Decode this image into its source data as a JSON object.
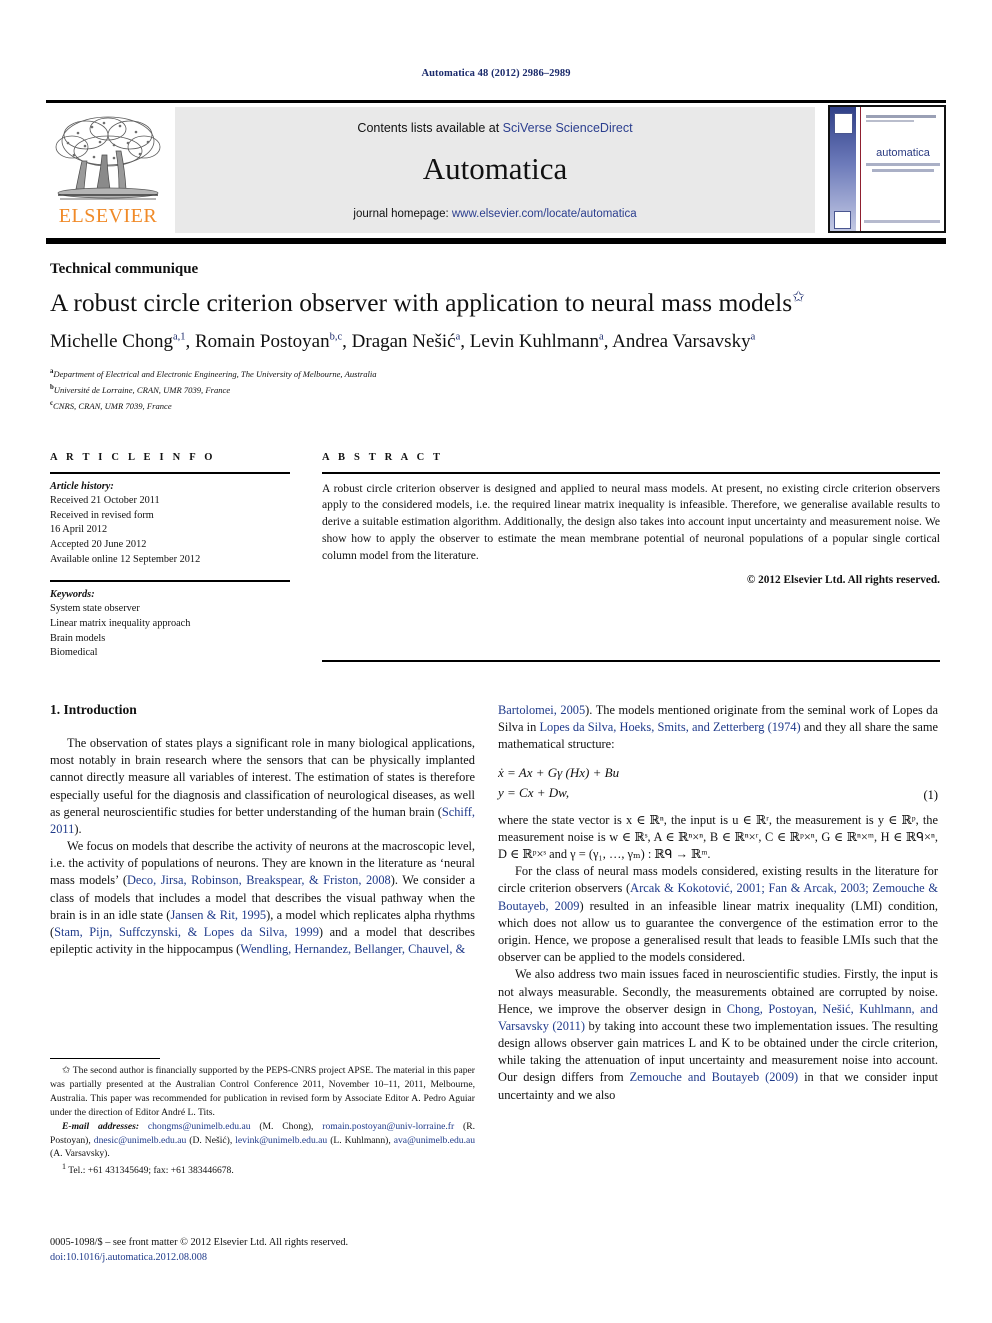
{
  "running_head": "Automatica 48 (2012) 2986–2989",
  "masthead": {
    "contents_prefix": "Contents lists available at ",
    "contents_link": "SciVerse ScienceDirect",
    "journal_title": "Automatica",
    "homepage_prefix": "journal homepage: ",
    "homepage_url": "www.elsevier.com/locate/automatica",
    "publisher_name": "ELSEVIER",
    "cover_journal_name": "automatica"
  },
  "article": {
    "section_label": "Technical communique",
    "title": "A robust circle criterion observer with application to neural mass models",
    "title_footnote_marker": "✩",
    "authors": [
      {
        "name": "Michelle Chong",
        "marks": "a,1"
      },
      {
        "name": "Romain Postoyan",
        "marks": "b,c"
      },
      {
        "name": "Dragan Nešić",
        "marks": "a"
      },
      {
        "name": "Levin Kuhlmann",
        "marks": "a"
      },
      {
        "name": "Andrea Varsavsky",
        "marks": "a"
      }
    ],
    "affiliations": [
      {
        "mark": "a",
        "text": "Department of Electrical and Electronic Engineering, The University of Melbourne, Australia"
      },
      {
        "mark": "b",
        "text": "Université de Lorraine, CRAN, UMR 7039, France"
      },
      {
        "mark": "c",
        "text": "CNRS, CRAN, UMR 7039, France"
      }
    ]
  },
  "article_info": {
    "heading": "A R T I C L E    I N F O",
    "history_label": "Article history:",
    "history": [
      "Received 21 October 2011",
      "Received in revised form",
      "16 April 2012",
      "Accepted 20 June 2012",
      "Available online 12 September 2012"
    ],
    "keywords_label": "Keywords:",
    "keywords": [
      "System state observer",
      "Linear matrix inequality approach",
      "Brain models",
      "Biomedical"
    ]
  },
  "abstract": {
    "heading": "A B S T R A C T",
    "text": "A robust circle criterion observer is designed and applied to neural mass models. At present, no existing circle criterion observers apply to the considered models, i.e. the required linear matrix inequality is infeasible. Therefore, we generalise available results to derive a suitable estimation algorithm. Additionally, the design also takes into account input uncertainty and measurement noise. We show how to apply the observer to estimate the mean membrane potential of neuronal populations of a popular single cortical column model from the literature.",
    "copyright": "© 2012 Elsevier Ltd. All rights reserved."
  },
  "body": {
    "section_number_title": "1. Introduction",
    "left_p1": "The observation of states plays a significant role in many biological applications, most notably in brain research where the sensors that can be physically implanted cannot directly measure all variables of interest. The estimation of states is therefore especially useful for the diagnosis and classification of neurological diseases, as well as general neuroscientific studies for better understanding of the human brain (",
    "left_p1_ref": "Schiff, 2011",
    "left_p1_tail": ").",
    "left_p2_a": "We focus on models that describe the activity of neurons at the macroscopic level, i.e. the activity of populations of neurons. They are known in the literature as ‘neural mass models’ (",
    "left_p2_ref1": "Deco, Jirsa, Robinson, Breakspear, & Friston, 2008",
    "left_p2_b": "). We consider a class of models that includes a model that describes the visual pathway when the brain is in an idle state (",
    "left_p2_ref2": "Jansen & Rit, 1995",
    "left_p2_c": "), a model which replicates alpha rhythms (",
    "left_p2_ref3": "Stam, Pijn, Suffczynski, & Lopes da Silva, 1999",
    "left_p2_d": ") and a model that describes epileptic activity in the hippocampus (",
    "left_p2_ref4": "Wendling, Hernandez, Bellanger, Chauvel, &",
    "right_p1_ref1": "Bartolomei, 2005",
    "right_p1_a": "). The models mentioned originate from the seminal work of Lopes da Silva in ",
    "right_p1_ref2": "Lopes da Silva, Hoeks, Smits, and Zetterberg (1974)",
    "right_p1_b": " and they all share the same mathematical structure:",
    "equation_line1": "ẋ = Ax + Gγ (Hx) + Bu",
    "equation_line2": "y = Cx + Dw,",
    "equation_number": "(1)",
    "right_p2": "where the state vector is x ∈ ℝⁿ, the input is u ∈ ℝʳ, the measurement is y ∈ ℝᵖ, the measurement noise is w ∈ ℝˢ, A ∈ ℝⁿ×ⁿ, B ∈ ℝⁿ×ʳ, C ∈ ℝᵖ×ⁿ, G ∈ ℝⁿ×ᵐ, H ∈ ℝᑫ×ⁿ, D ∈ ℝᵖ×ˢ and γ = (γ₁, …, γₘ) : ℝᑫ → ℝᵐ.",
    "right_p3_a": "For the class of neural mass models considered, existing results in the literature for circle criterion observers (",
    "right_p3_ref": "Arcak & Kokotović, 2001; Fan & Arcak, 2003; Zemouche & Boutayeb, 2009",
    "right_p3_b": ") resulted in an infeasible linear matrix inequality (LMI) condition, which does not allow us to guarantee the convergence of the estimation error to the origin. Hence, we propose a generalised result that leads to feasible LMIs such that the observer can be applied to the models considered.",
    "right_p4_a": "We also address two main issues faced in neuroscientific studies. Firstly, the input is not always measurable. Secondly, the measurements obtained are corrupted by noise. Hence, we improve the observer design in ",
    "right_p4_ref1": "Chong, Postoyan, Nešić, Kuhlmann, and Varsavsky (2011)",
    "right_p4_b": " by taking into account these two implementation issues. The resulting design allows observer gain matrices L and K to be obtained under the circle criterion, while taking the attenuation of input uncertainty and measurement noise into account. Our design differs from ",
    "right_p4_ref2": "Zemouche and Boutayeb (2009)",
    "right_p4_c": " in that we consider input uncertainty and we also"
  },
  "footnotes": {
    "star_marker": "✩",
    "star_text": "The second author is financially supported by the PEPS-CNRS project APSE. The material in this paper was partially presented at the Australian Control Conference 2011, November 10–11, 2011, Melbourne, Australia. This paper was recommended for publication in revised form by Associate Editor A. Pedro Aguiar under the direction of Editor André L. Tits.",
    "email_label": "E-mail addresses:",
    "emails": [
      {
        "address": "chongms@unimelb.edu.au",
        "owner": "(M. Chong),"
      },
      {
        "address": "romain.postoyan@univ-lorraine.fr",
        "owner": "(R. Postoyan),"
      },
      {
        "address": "dnesic@unimelb.edu.au",
        "owner": "(D. Nešić),"
      },
      {
        "address": "levink@unimelb.edu.au",
        "owner": "(L. Kuhlmann),"
      },
      {
        "address": "ava@unimelb.edu.au",
        "owner": "(A. Varsavsky)."
      }
    ],
    "tel_marker": "1",
    "tel_text": "Tel.: +61 431345649; fax: +61 383446678."
  },
  "imprint": {
    "issn_line": "0005-1098/$ – see front matter © 2012 Elsevier Ltd. All rights reserved.",
    "doi_line": "doi:10.1016/j.automatica.2012.08.008"
  },
  "colors": {
    "link_blue": "#2c3f8f",
    "ref_blue": "#1f3a8a",
    "elsevier_orange": "#f08a28",
    "banner_gray": "#e9e9e9"
  }
}
